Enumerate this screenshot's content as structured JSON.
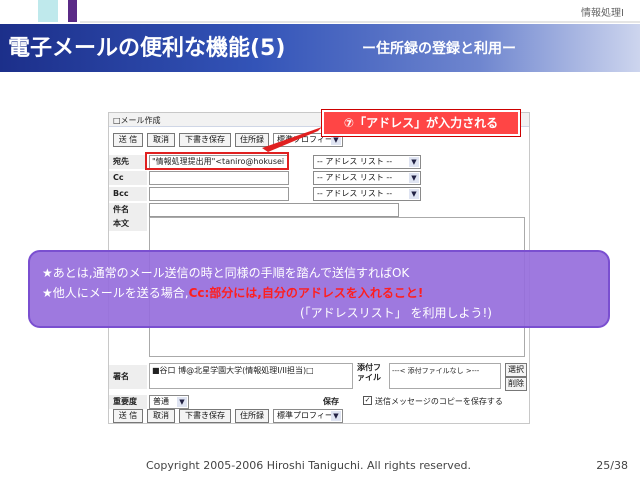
{
  "header": {
    "course": "情報処理Ⅰ",
    "title": "電子メールの便利な機能(5)",
    "subtitle": "ー住所録の登録と利用ー"
  },
  "form": {
    "heading": "□メール作成",
    "toolbar": [
      "送 信",
      "取消",
      "下書き保存",
      "住所録"
    ],
    "profile": "標準プロフィール",
    "to_label": "宛先",
    "to_value": "\"情報処理提出用\"<taniro@hokusei",
    "cc_label": "Cc",
    "bcc_label": "Bcc",
    "subject_label": "件名",
    "body_label": "本文",
    "address_list": "-- アドレス リスト --",
    "signature_label": "署名",
    "signature_value": "■谷口 博@北星学園大学(情報処理I/II担当)□",
    "attach_label": "添付ファイル",
    "attach_value": "---< 添付ファイルなし >---",
    "select_button": "選択",
    "delete_button": "削除",
    "priority_label": "重要度",
    "priority_value": "普通",
    "save_label": "保存",
    "save_copy_label": "送信メッセージのコピーを保存する"
  },
  "callout": {
    "text": "⑦「アドレス」が入力される"
  },
  "info": {
    "line1": "★あとは,通常のメール送信の時と同様の手順を踏んで送信すればOK",
    "line2_prefix": "★他人にメールを送る場合,",
    "line2_warning": "Cc:部分には,自分のアドレスを入れること!",
    "line3": "(「アドレスリスト」 を利用しよう!)"
  },
  "footer": {
    "copyright": "Copyright 2005-2006 Hiroshi Taniguchi. All rights reserved.",
    "page": "25/38"
  },
  "colors": {
    "title_bar": "#1c2f8a",
    "callout": "#ff4545",
    "overlay": "#966edc",
    "warning": "#ff1e1e"
  }
}
